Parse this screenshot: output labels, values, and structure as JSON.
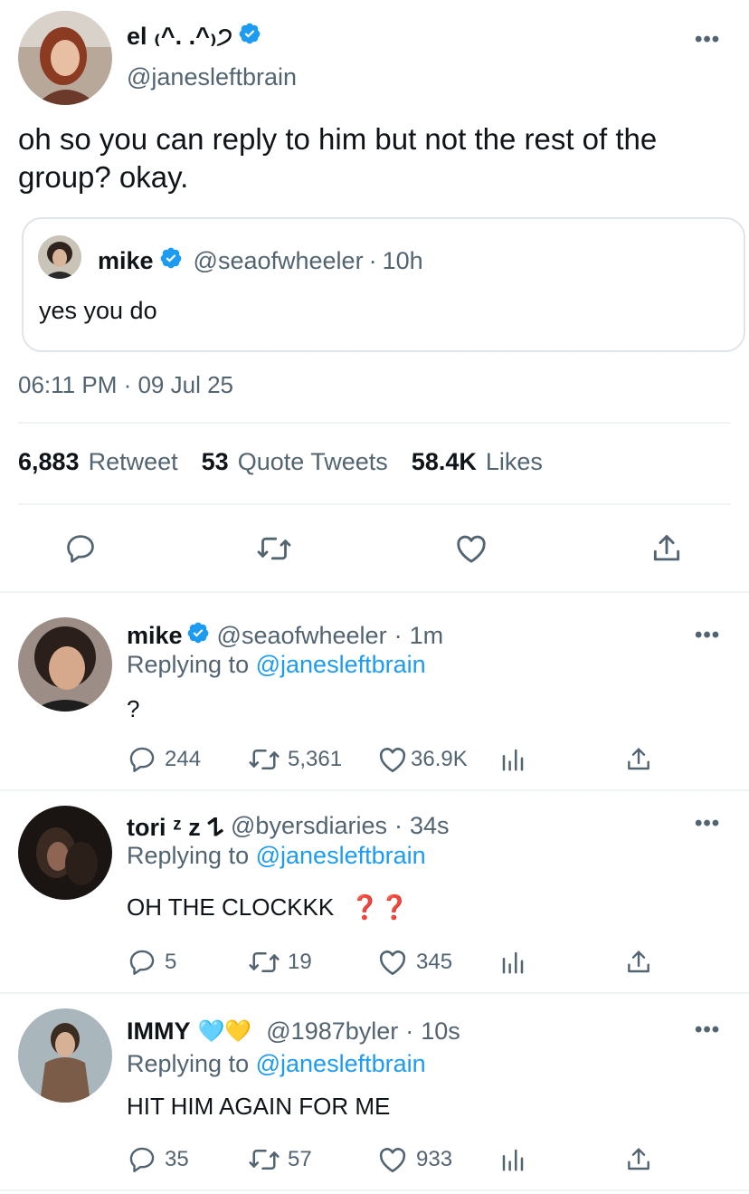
{
  "tweet": {
    "author": {
      "name": "el ₍^. .^₎੭",
      "handle": "@janesleftbrain",
      "verified": true
    },
    "text": "oh so you can reply to him but not the rest of the group? okay.",
    "more_label": "•••",
    "quoted": {
      "name": "mike",
      "handle": "@seaofwheeler",
      "separator": "·",
      "time": "10h",
      "text": "yes you do",
      "verified": true
    },
    "timestamp": "06:11 PM · 09 Jul 25",
    "stats": {
      "retweets_count": "6,883",
      "retweets_label": "Retweet",
      "quotes_count": "53",
      "quotes_label": "Quote Tweets",
      "likes_count": "58.4K",
      "likes_label": "Likes"
    },
    "actions": [
      "reply-icon",
      "retweet-icon",
      "like-icon",
      "share-icon"
    ]
  },
  "replies": [
    {
      "name": "mike",
      "verified": true,
      "handle": "@seaofwheeler",
      "separator": "·",
      "time": "1m",
      "replying_prefix": "Replying to",
      "replying_to": "@janesleftbrain",
      "text": "?",
      "reply_count": "244",
      "retweet_count": "5,361",
      "like_count": "36.9K"
    },
    {
      "name": "tori ᶻ z 𐰁",
      "verified": false,
      "handle": "@byersdiaries",
      "separator": "·",
      "time": "34s",
      "replying_prefix": "Replying to",
      "replying_to": "@janesleftbrain",
      "text": "OH THE CLOCKKK",
      "emoji": "❓❓",
      "reply_count": "5",
      "retweet_count": "19",
      "like_count": "345"
    },
    {
      "name": "IMMY",
      "verified": false,
      "emoji": "🩵💛",
      "handle": "@1987byler",
      "separator": "·",
      "time": "10s",
      "replying_prefix": "Replying to",
      "replying_to": "@janesleftbrain",
      "text": "HIT HIM AGAIN FOR ME",
      "reply_count": "35",
      "retweet_count": "57",
      "like_count": "933"
    }
  ],
  "colors": {
    "accent": "#1d9bf0",
    "muted": "#536471",
    "divider": "#eff3f4",
    "text": "#0f1419"
  }
}
